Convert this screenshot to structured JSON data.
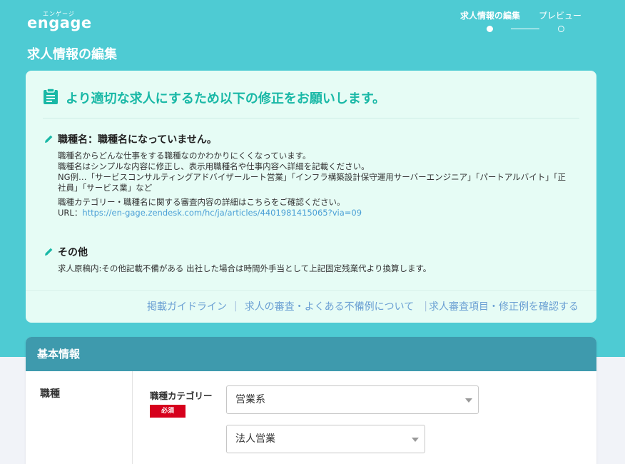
{
  "header": {
    "logo_ruby": "エンゲージ",
    "logo_text": "engage",
    "steps": [
      {
        "label": "求人情報の編集",
        "active": true
      },
      {
        "label": "プレビュー",
        "active": false
      }
    ]
  },
  "page_title": "求人情報の編集",
  "notice": {
    "title": "より適切な求人にするため以下の修正をお願いします。",
    "issues": [
      {
        "title": "職種名：職種名になっていません。",
        "lines": [
          "職種名からどんな仕事をする職種なのかわかりにくくなっています。",
          "職種名はシンプルな内容に修正し、表示用職種名や仕事内容へ詳細を記載ください。",
          "NG例…「サービスコンサルティングアドバイザールート営業」「インフラ構築設計保守運用サーバーエンジニア」「パートアルバイト」「正社員」「サービス業」など"
        ],
        "detail_line": "職種カテゴリー・職種名に関する審査内容の詳細はこちらをご確認ください。",
        "url_label": "URL：",
        "url": "https://en-gage.zendesk.com/hc/ja/articles/4401981415065?via=09"
      },
      {
        "title": "その他",
        "lines": [
          "求人原稿内:その他記載不備がある 出社した場合は時間外手当として上記固定残業代より換算します。"
        ]
      }
    ],
    "links": [
      "掲載ガイドライン",
      "求人の審査・よくある不備例について",
      "求人審査項目・修正例を確認する"
    ],
    "link_separators": [
      "|",
      "|"
    ]
  },
  "basic_info": {
    "header": "基本情報",
    "row_label": "職種",
    "field_label": "職種カテゴリー",
    "required_badge": "必須",
    "select_category": "営業系",
    "select_subcategory": "法人営業"
  },
  "colors": {
    "brand_teal": "#4ecbd3",
    "notice_bg": "#e6fcf5",
    "notice_accent": "#19b8a6",
    "section_header": "#3e9aad",
    "required_red": "#d6001c",
    "link_blue": "#6a9fd3"
  },
  "icons": {
    "notice": "clipboard-icon",
    "issue": "pencil-icon",
    "select": "chevron-down-icon"
  }
}
